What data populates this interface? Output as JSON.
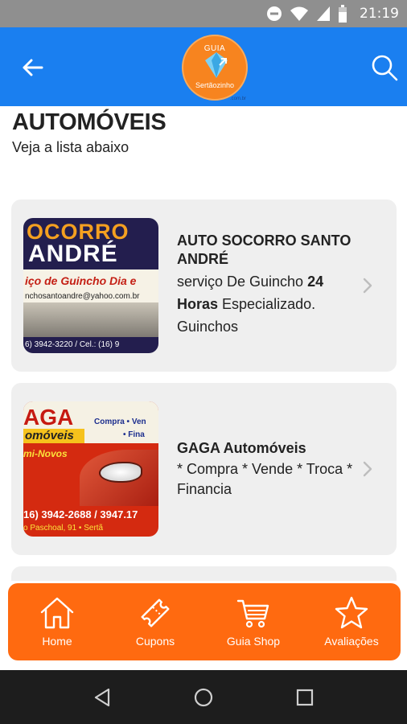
{
  "status_bar": {
    "time": "21:19",
    "icons": [
      "dnd-icon",
      "wifi-icon",
      "signal-icon",
      "battery-icon"
    ]
  },
  "app_bar": {
    "background": "#1a7ff0",
    "logo": {
      "top_text": "GUIA",
      "bottom_text": "Sertãozinho",
      "suffix": ".com.br"
    }
  },
  "page": {
    "title": "AUTOMÓVEIS",
    "subtitle": "Veja a lista abaixo"
  },
  "listings": [
    {
      "name": "AUTO SOCORRO SANTO ANDRÉ",
      "desc_plain_1": "serviço De Guincho ",
      "desc_bold": "24 Horas",
      "desc_plain_2": " Especializado. Guinchos",
      "image": {
        "line1": "OCORRO",
        "line2": "ANDRÉ",
        "line3": "iço de Guincho Dia e",
        "line4": "nchosantoandre@yahoo.com.br",
        "line5": "6) 3942-3220 / Cel.: (16) 9"
      }
    },
    {
      "name": "GAGA Automóveis",
      "desc": "* Compra * Vende * Troca * Financia",
      "image": {
        "line1": "AGA",
        "line2": "omóveis",
        "line3": "Compra • Ven",
        "line4": "• Fina",
        "line5": "mi-Novos",
        "line6": "16) 3942-2688 / 3947.17",
        "line7": "o Paschoal, 91 • Sertã"
      }
    }
  ],
  "bottom_nav": {
    "background": "#ff6a10",
    "items": [
      {
        "label": "Home",
        "icon": "home-icon"
      },
      {
        "label": "Cupons",
        "icon": "ticket-icon"
      },
      {
        "label": "Guia Shop",
        "icon": "cart-icon"
      },
      {
        "label": "Avaliações",
        "icon": "star-icon"
      }
    ]
  },
  "system_nav": {
    "buttons": [
      "back-triangle-icon",
      "home-circle-icon",
      "recents-square-icon"
    ]
  }
}
